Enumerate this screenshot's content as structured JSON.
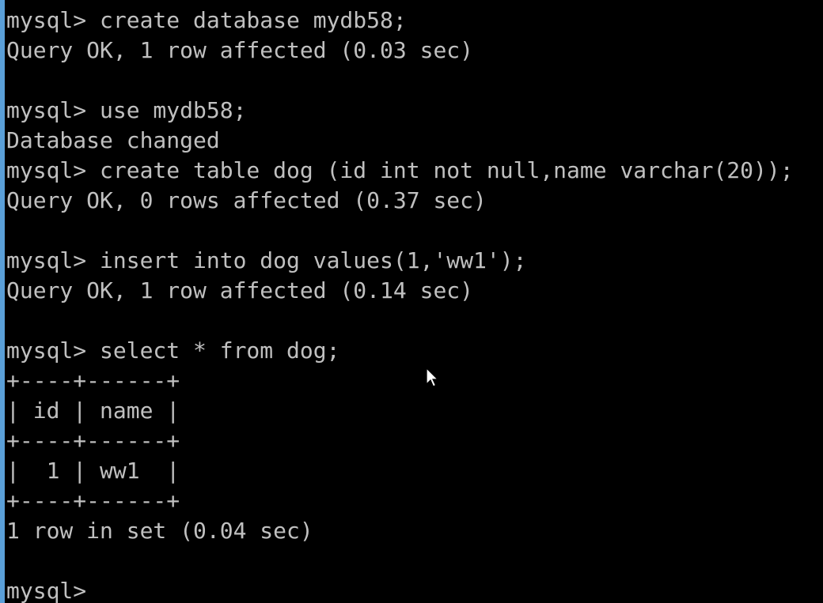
{
  "terminal": {
    "lines": [
      "mysql> create database mydb58;",
      "Query OK, 1 row affected (0.03 sec)",
      "",
      "mysql> use mydb58;",
      "Database changed",
      "mysql> create table dog (id int not null,name varchar(20));",
      "Query OK, 0 rows affected (0.37 sec)",
      "",
      "mysql> insert into dog values(1,'ww1');",
      "Query OK, 1 row affected (0.14 sec)",
      "",
      "mysql> select * from dog;",
      "+----+------+",
      "| id | name |",
      "+----+------+",
      "|  1 | ww1  |",
      "+----+------+",
      "1 row in set (0.04 sec)",
      "",
      "mysql>"
    ]
  },
  "colors": {
    "background": "#000000",
    "text": "#c0c0c0",
    "window_edge": "#5a9fd8"
  },
  "icons": {
    "pointer": "mouse-pointer-icon"
  }
}
